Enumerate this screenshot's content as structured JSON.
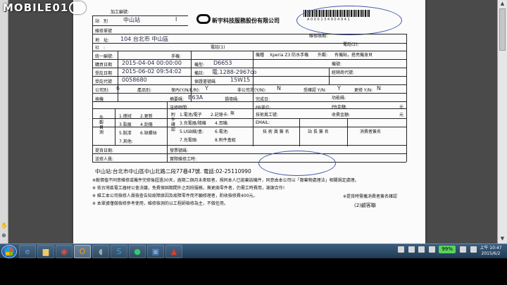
{
  "watermark": {
    "text": "MOBILE01"
  },
  "form": {
    "title_label": "加工編號:",
    "store_label": "站　別",
    "store_value": "中山站",
    "store_code": "I",
    "repair_order_label": "維修單號",
    "company_name": "新宇科技服務股份有限公司",
    "barcode_number": "A 0 0 0 1 3 4 9 0 4 9 4 1",
    "repair_deadline_label": "維修限期:",
    "address_label": "地　址:",
    "address_value": "104  台北市 中山區",
    "phone1_label": "電話(1)",
    "phone2_label": "電話(2):",
    "social_label": "社　:",
    "model_name_label": "機種",
    "model_name_value": "Xperia Z3 防水手機",
    "appearance_label": "外觀:",
    "appearance_value": "有機貼，搭亮機身貝",
    "tax_id_label": "統一編號:",
    "mobile_label": "手機:",
    "machine_no_label": "機號:",
    "purchase_date_label": "購買日期",
    "purchase_date_value": "2015-04-04 00:00:00",
    "model_label": "機型:",
    "model_value": "D6653",
    "received_date_label": "受訖日期",
    "received_date_value": "2015-06-02 09:54:02",
    "remark_label": "備註:",
    "remark_value": "電.1288-2967co",
    "distributor_label": "經銷商代號:",
    "code_label": "受訖代號",
    "code_value": "0058680",
    "warranty_label": "保證書號碼",
    "warranty_value": "15W15",
    "company_label": "公司別:",
    "company_value": "6",
    "product_label": "產品別:",
    "in_warranty_label": "保內(Y/N/E/R):",
    "in_warranty_value": "Y",
    "invoice_label": "非公司貨(Y/N):",
    "invoice_value": "N",
    "confirm_label": "受確認 Y/N:",
    "confirm_value": "Y",
    "change_label": "更修 Y/N:",
    "change_value": "N",
    "fault_label": "換機",
    "serial_label": "摘要碼:",
    "serial_value": "B63A",
    "fault_code_label": "損壞碼:",
    "done_date_label": "完成日:",
    "func_code_label": "功能碼:",
    "repair_time_label": "送修時間:",
    "pr_unit_label": "PR單位:",
    "pr_amount_label": "PR金額:",
    "pr_amount_unit": "元",
    "tech_label": "技術員工號:",
    "fee_label": "收費金額:",
    "fee_unit": "元",
    "email_label": "EMAIL:",
    "tech_sign_label": "技 術 員 簽 名",
    "station_sign_label": "站 長 簽 名",
    "customer_sign_label": "消費者簽名",
    "accessories_title": "附件確認",
    "appearance_title": "外觀目測",
    "checks": [
      "1.擦拭",
      "2.更新",
      "3.裂痕",
      "4.刮傷",
      "5.脫漆",
      "6.缺螺絲",
      "7.其他:"
    ],
    "attachments": [
      "1.電池/電子",
      "2.記憶卡:",
      "3.充電器/隨機",
      "4.耳機:",
      "5.USB線/盒:",
      "6.電池:",
      "7.充電頭:",
      "8.附件盒組"
    ],
    "none_value": "無",
    "date_pick_label": "提貨日期:",
    "rebate_label": "發票號碼:",
    "actual_repair_label": "實際維修工時:",
    "repair_person_label": "送修人員:",
    "store_address": "中山站:台北市中山區中山北路二段77巷47號. 電話:02-25110990",
    "notes": [
      "※敝價值不同意維修或機件完修後超過30天，逾期二個月未來取者，視同本人已拋棄該機件，同意由本公司以「廢棄物處理法」相關規定處理。",
      "※ 依台灣區電工器材公會決議，免費保固期間外之到府服務，無更換零件者，仍需工時費用，謝謝合作!",
      "※ 維工本公司檢修人員檢查告知故障原因及故障零件而不願修理者，酌收檢修費400元。",
      "※ 本單據僅做檢修參考使用，維修檢測的以工程師檢修為主，不做任用。"
    ],
    "copy_label": "(2)顧客聯",
    "receipt_note": "※提貨時需攜消費者簽名確認"
  },
  "taskbar": {
    "apps": [
      "ie-icon",
      "folder-icon",
      "chrome-icon",
      "outlook-icon",
      "media-icon",
      "skype-icon",
      "line-icon",
      "uac-icon",
      "pdf-icon"
    ],
    "battery": "99%",
    "time": "上午 10:47",
    "date": "2015/6/2"
  }
}
